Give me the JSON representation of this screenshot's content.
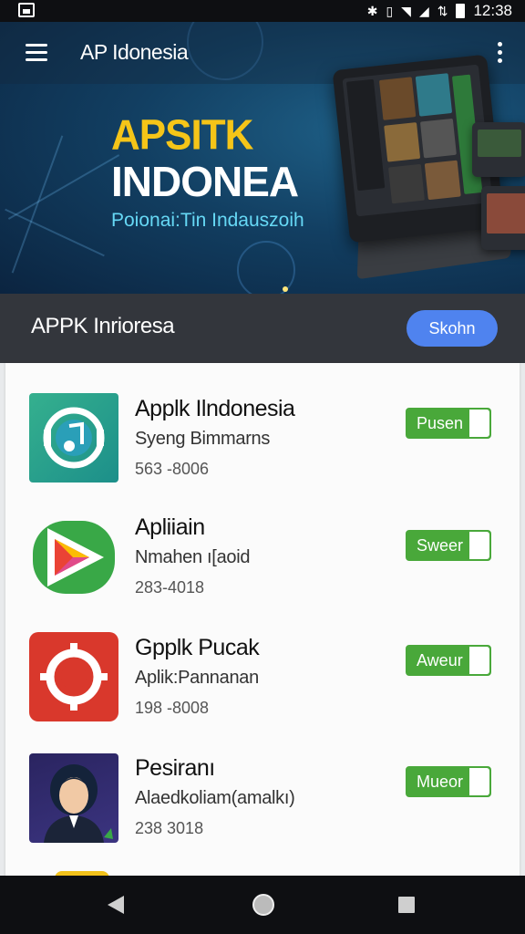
{
  "status_bar": {
    "time": "12:38"
  },
  "app_bar": {
    "title": "AP Idonesia"
  },
  "hero": {
    "title_line1": "APSITK",
    "title_line2": "INDONEA",
    "subtitle": "Poionai:Tin Indauszoih"
  },
  "section": {
    "title": "APPK Inrioresa",
    "button_label": "Skohn"
  },
  "apps": [
    {
      "name": "Applk Ilndonesia",
      "subtitle": "Syeng Bimmarns",
      "meta": "563 -8006",
      "button": "Pusen"
    },
    {
      "name": "Apliiain",
      "subtitle": "Nmahen ı[aoid",
      "meta": "283-4018",
      "button": "Sweer"
    },
    {
      "name": "Gpplk Pucak",
      "subtitle": "Aplik:Pannanan",
      "meta": "198 -8008",
      "button": "Aweur"
    },
    {
      "name": "Pesiranı",
      "subtitle": "Alaedkoliam(amalkı)",
      "meta": "238 3018",
      "button": "Mueor"
    }
  ],
  "colors": {
    "hero_title_yellow": "#f5c518",
    "hero_subtitle_cyan": "#66d8f5",
    "button_green": "#49a83a",
    "section_button_blue": "#4f83ef"
  }
}
